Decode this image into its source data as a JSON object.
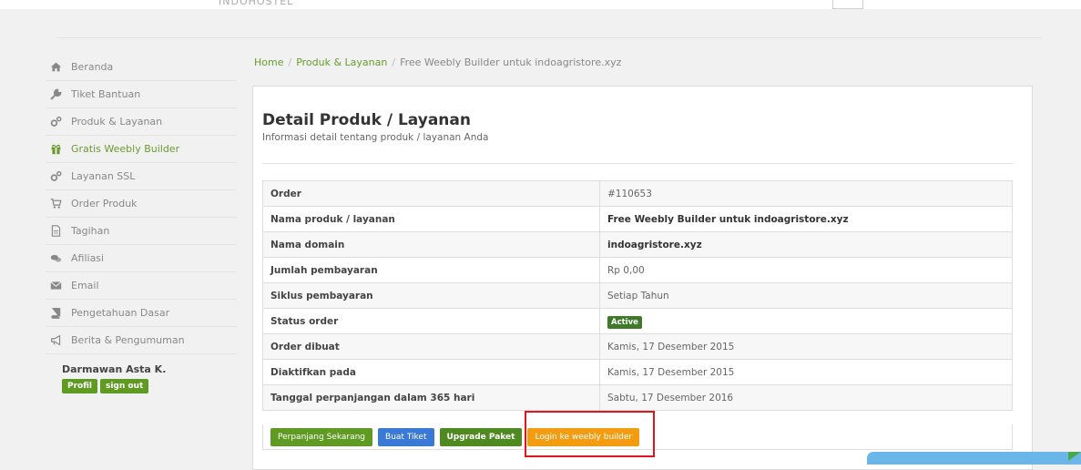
{
  "header": {
    "logo_fragment": "INDOHOSTEL"
  },
  "sidebar": {
    "items": [
      {
        "label": "Beranda",
        "icon": "home-icon"
      },
      {
        "label": "Tiket Bantuan",
        "icon": "wrench-icon"
      },
      {
        "label": "Produk & Layanan",
        "icon": "cogs-icon"
      },
      {
        "label": "Gratis Weebly Builder",
        "icon": "gift-icon",
        "active": true
      },
      {
        "label": "Layanan SSL",
        "icon": "cogs-icon"
      },
      {
        "label": "Order Produk",
        "icon": "cart-icon"
      },
      {
        "label": "Tagihan",
        "icon": "file-icon"
      },
      {
        "label": "Afiliasi",
        "icon": "comments-icon"
      },
      {
        "label": "Email",
        "icon": "envelope-icon"
      },
      {
        "label": "Pengetahuan Dasar",
        "icon": "book-icon"
      },
      {
        "label": "Berita & Pengumuman",
        "icon": "bullhorn-icon"
      }
    ],
    "user": {
      "name": "Darmawan Asta K.",
      "profile_label": "Profil",
      "signout_label": "sign out"
    }
  },
  "breadcrumb": {
    "home": "Home",
    "section": "Produk & Layanan",
    "current": "Free Weebly Builder untuk indoagristore.xyz"
  },
  "page": {
    "title": "Detail Produk / Layanan",
    "subtitle": "Informasi detail tentang produk / layanan Anda"
  },
  "details": [
    {
      "label": "Order",
      "value": "#110653"
    },
    {
      "label": "Nama produk / layanan",
      "value": "Free Weebly Builder untuk indoagristore.xyz"
    },
    {
      "label": "Nama domain",
      "value": "indoagristore.xyz"
    },
    {
      "label": "Jumlah pembayaran",
      "value": "Rp 0,00"
    },
    {
      "label": "Siklus pembayaran",
      "value": "Setiap Tahun"
    },
    {
      "label": "Status order",
      "value": "Active"
    },
    {
      "label": "Order dibuat",
      "value": "Kamis, 17 Desember 2015"
    },
    {
      "label": "Diaktifkan pada",
      "value": "Kamis, 17 Desember 2015"
    },
    {
      "label": "Tanggal perpanjangan dalam 365 hari",
      "value": "Sabtu, 17 Desember 2016"
    }
  ],
  "actions": {
    "renew": "Perpanjang Sekarang",
    "ticket": "Buat Tiket",
    "upgrade": "Upgrade Paket",
    "login_weebly": "Login ke weebly builder"
  },
  "colors": {
    "accent": "#6a9b2e",
    "button_green": "#5f9a22",
    "button_blue": "#3a79d6",
    "button_orange": "#f39c12",
    "highlight": "#e0161d"
  }
}
